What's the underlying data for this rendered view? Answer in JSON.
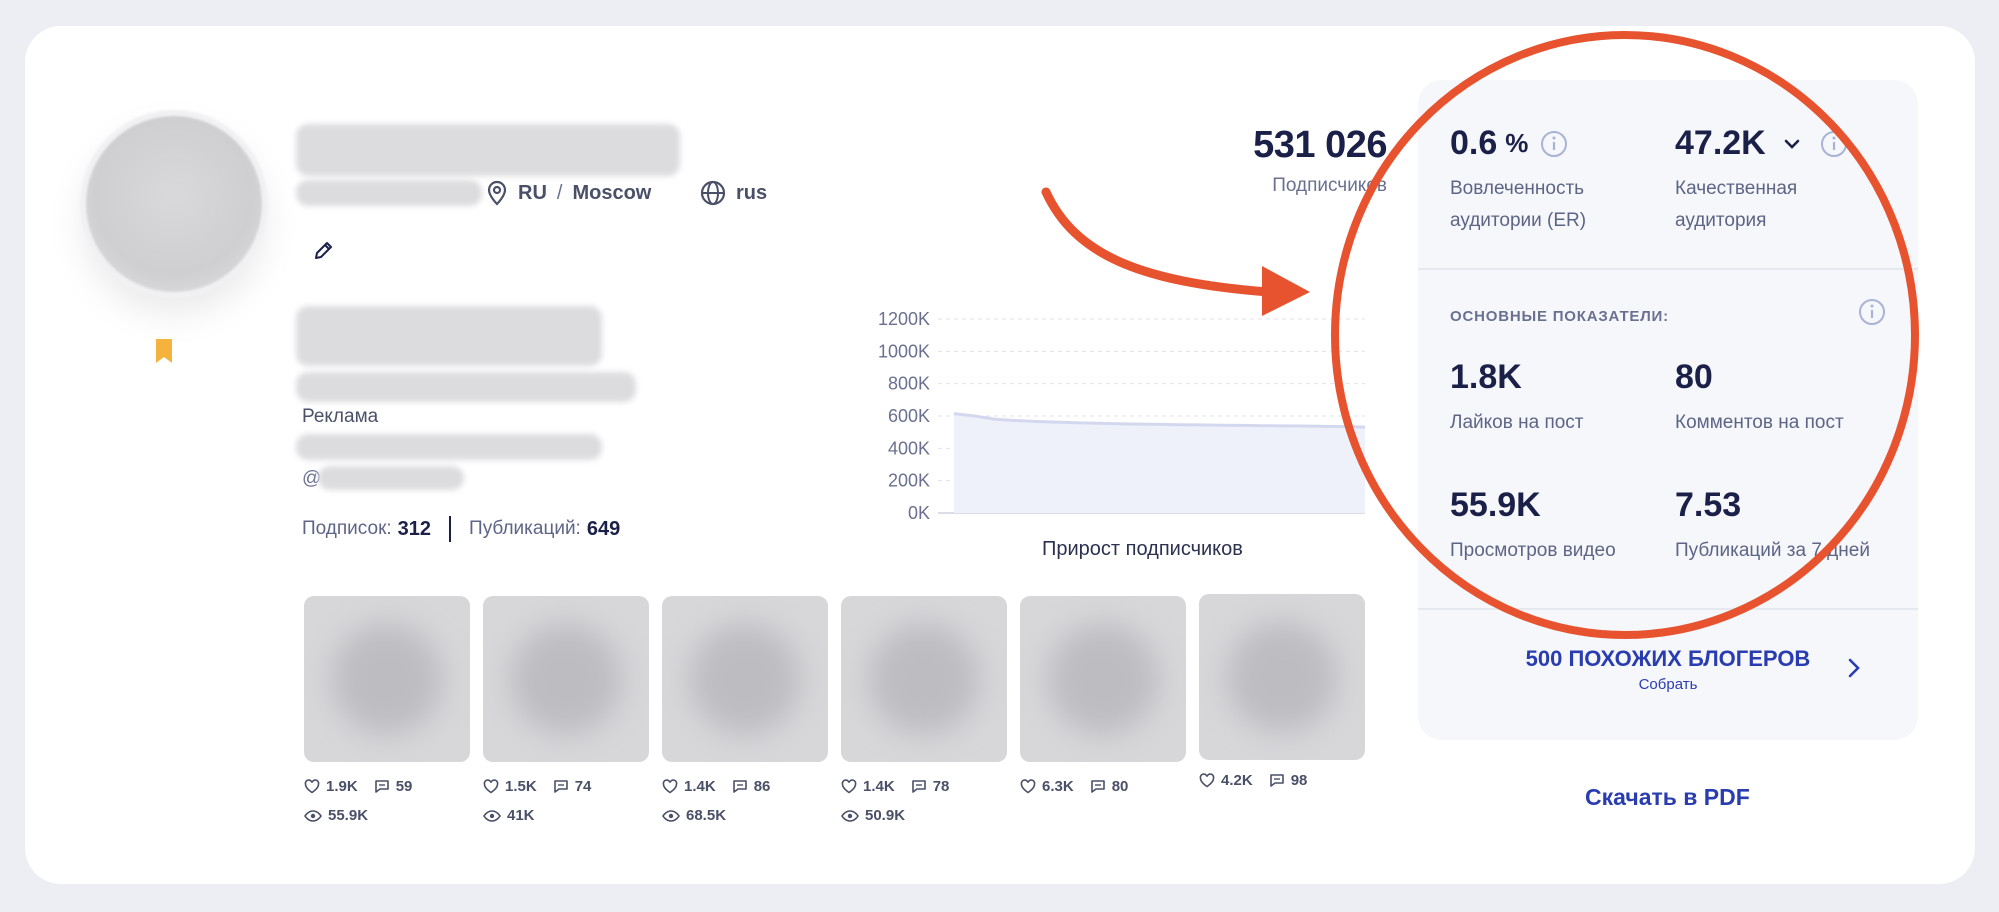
{
  "profile": {
    "country": "RU",
    "city": "Moscow",
    "separator": "/",
    "language": "rus",
    "ad_label": "Реклама",
    "handle_prefix": "@",
    "following_label": "Подписок:",
    "following_value": "312",
    "posts_label": "Публикаций:",
    "posts_value": "649"
  },
  "followers": {
    "value": "531 026",
    "label": "Подписчиков"
  },
  "chart_data": {
    "type": "area",
    "title": "Прирост подписчиков",
    "y_ticks": [
      "1200K",
      "1000K",
      "800K",
      "600K",
      "400K",
      "200K",
      "0K"
    ],
    "ylim": [
      0,
      1200
    ],
    "x": [
      0,
      1,
      2,
      3,
      4,
      5,
      6,
      7,
      8,
      9,
      10,
      11,
      12,
      13,
      14,
      15,
      16,
      17,
      18,
      19,
      20
    ],
    "series": [
      {
        "values": [
          615,
          600,
          580,
          572,
          566,
          562,
          558,
          555,
          552,
          550,
          548,
          546,
          545,
          543,
          542,
          540,
          539,
          538,
          536,
          535,
          531
        ]
      }
    ],
    "grid": true
  },
  "posts": [
    {
      "likes": "1.9K",
      "comments": "59",
      "views": "55.9K"
    },
    {
      "likes": "1.5K",
      "comments": "74",
      "views": "41K"
    },
    {
      "likes": "1.4K",
      "comments": "86",
      "views": "68.5K"
    },
    {
      "likes": "1.4K",
      "comments": "78",
      "views": "50.9K"
    },
    {
      "likes": "6.3K",
      "comments": "80",
      "views": ""
    },
    {
      "likes": "4.2K",
      "comments": "98",
      "views": ""
    }
  ],
  "metrics": {
    "er_value": "0.6",
    "er_unit": "%",
    "er_label_1": "Вовлеченность",
    "er_label_2": "аудитории (ER)",
    "quality_value": "47.2K",
    "quality_label_1": "Качественная",
    "quality_label_2": "аудитория",
    "section_title": "ОСНОВНЫЕ ПОКАЗАТЕЛИ:",
    "likes_value": "1.8K",
    "likes_label": "Лайков на пост",
    "comments_value": "80",
    "comments_label": "Комментов на пост",
    "views_value": "55.9K",
    "views_label": "Просмотров видео",
    "pubs_value": "7.53",
    "pubs_label": "Публикаций за 7 дней"
  },
  "similar": {
    "title": "500 ПОХОЖИХ БЛОГЕРОВ",
    "subtitle": "Собрать"
  },
  "pdf_label": "Скачать в PDF",
  "colors": {
    "accent_blue": "#2a3db0",
    "annotation_red": "#e8532f",
    "bookmark_orange": "#f5b23d",
    "navy": "#1b2049"
  }
}
